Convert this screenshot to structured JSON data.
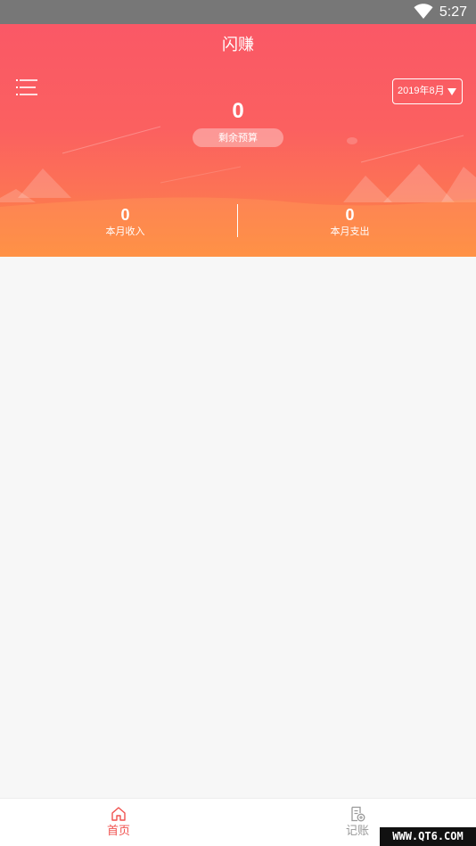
{
  "status_bar": {
    "time": "5:27",
    "icons": [
      "wifi-icon"
    ]
  },
  "header": {
    "app_title": "闪赚",
    "menu_icon": "menu-icon",
    "date_picker": {
      "value": "2019年8月",
      "icon": "caret-down-icon"
    },
    "budget": {
      "value": "0",
      "label": "剩余预算"
    },
    "income": {
      "value": "0",
      "label": "本月收入"
    },
    "expense": {
      "value": "0",
      "label": "本月支出"
    },
    "colors": {
      "top": "#fa5866",
      "bottom": "#ff8a3b"
    }
  },
  "tab_bar": {
    "tabs": [
      {
        "label": "首页",
        "icon": "home-icon",
        "active": true,
        "color": "#f0524f"
      },
      {
        "label": "记账",
        "icon": "record-icon",
        "active": false,
        "color": "#999999"
      }
    ]
  },
  "watermark": {
    "text": "WWW.QT6.COM"
  }
}
